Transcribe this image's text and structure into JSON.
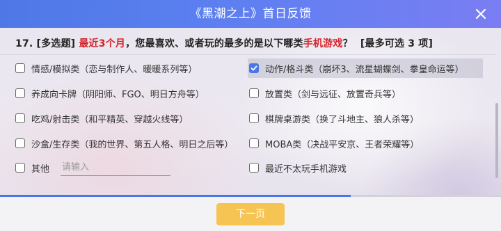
{
  "header": {
    "title": "《黑潮之上》首日反馈"
  },
  "question": {
    "number": "17.",
    "type": "[多选题]",
    "highlight1": "最近3个月",
    "text_mid": "，您最喜欢、或者玩的最多的是以下哪类",
    "highlight2": "手机游戏",
    "text_end": "？",
    "limit": "[最多可选 3 项]"
  },
  "options": [
    {
      "label": "情感/模拟类（恋与制作人、暖暖系列等）",
      "checked": false
    },
    {
      "label": "动作/格斗类（崩坏3、流星蝴蝶剑、拳皇命运等）",
      "checked": true
    },
    {
      "label": "养成向卡牌（阴阳师、FGO、明日方舟等）",
      "checked": false
    },
    {
      "label": "放置类（剑与远征、放置奇兵等）",
      "checked": false
    },
    {
      "label": "吃鸡/射击类（和平精英、穿越火线等）",
      "checked": false
    },
    {
      "label": "棋牌桌游类（换了斗地主、狼人杀等）",
      "checked": false
    },
    {
      "label": "沙盒/生存类（我的世界、第五人格、明日之后等）",
      "checked": false
    },
    {
      "label": "MOBA类（决战平安京、王者荣耀等）",
      "checked": false
    },
    {
      "label": "其他",
      "checked": false,
      "placeholder": "请输入"
    },
    {
      "label": "最近不太玩手机游戏",
      "checked": false
    }
  ],
  "footer": {
    "next_label": "下一页",
    "progress": 0.7
  },
  "colors": {
    "accent": "#4a76e8",
    "highlight": "#d6222a",
    "button": "#f6c453"
  }
}
